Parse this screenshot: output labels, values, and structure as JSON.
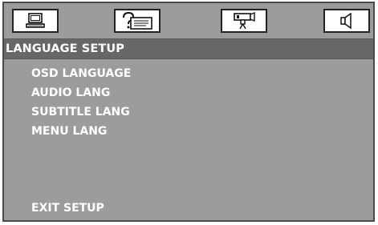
{
  "header": {
    "tabs": [
      {
        "icon": "computer-icon"
      },
      {
        "icon": "help-question-icon"
      },
      {
        "icon": "video-camera-icon"
      },
      {
        "icon": "speaker-icon"
      }
    ]
  },
  "section": {
    "title": "LANGUAGE SETUP"
  },
  "menu": {
    "items": [
      {
        "label": "OSD LANGUAGE"
      },
      {
        "label": "AUDIO LANG"
      },
      {
        "label": "SUBTITLE LANG"
      },
      {
        "label": "MENU LANG"
      }
    ],
    "exit_label": "EXIT SETUP"
  },
  "colors": {
    "panel_bg": "#9c9c9c",
    "title_bar_bg": "#676767",
    "text": "#ffffff",
    "border": "#4a4a4a"
  }
}
